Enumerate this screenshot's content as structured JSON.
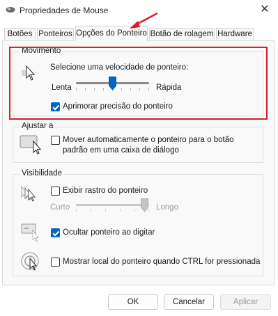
{
  "window": {
    "title": "Propriedades de Mouse",
    "close_glyph": "✕",
    "app_icon": "mouse-icon"
  },
  "tabs": [
    {
      "label": "Botões"
    },
    {
      "label": "Ponteiros"
    },
    {
      "label": "Opções do Ponteiro",
      "active": true
    },
    {
      "label": "Botão de rolagem"
    },
    {
      "label": "Hardware"
    }
  ],
  "motion": {
    "title": "Movimento",
    "prompt": "Selecione uma velocidade de ponteiro:",
    "slow_label": "Lenta",
    "fast_label": "Rápida",
    "speed_level": 0.5,
    "precision_label": "Aprimorar precisão do ponteiro",
    "precision_checked": true,
    "icon": "pointer-speed-icon"
  },
  "snap": {
    "title": "Ajustar a",
    "label_line1": "Mover automaticamente o ponteiro para o botão",
    "label_line2": "padrão em uma caixa de diálogo",
    "checked": false,
    "icon": "snap-to-button-icon"
  },
  "visibility": {
    "title": "Visibilidade",
    "trails_label": "Exibir rastro do ponteiro",
    "trails_checked": false,
    "short_label": "Curto",
    "long_label": "Longo",
    "trail_level": 1.0,
    "hide_label": "Ocultar ponteiro ao digitar",
    "hide_checked": true,
    "show_location_label": "Mostrar local do ponteiro quando CTRL for pressionada",
    "show_location_checked": false,
    "icons": [
      "pointer-trails-icon",
      "hide-pointer-icon",
      "pointer-location-icon"
    ]
  },
  "buttons": {
    "ok": "OK",
    "cancel": "Cancelar",
    "apply": "Aplicar"
  },
  "annotation": {
    "color": "#d6202d",
    "arrow_icon": "red-arrow-icon"
  }
}
